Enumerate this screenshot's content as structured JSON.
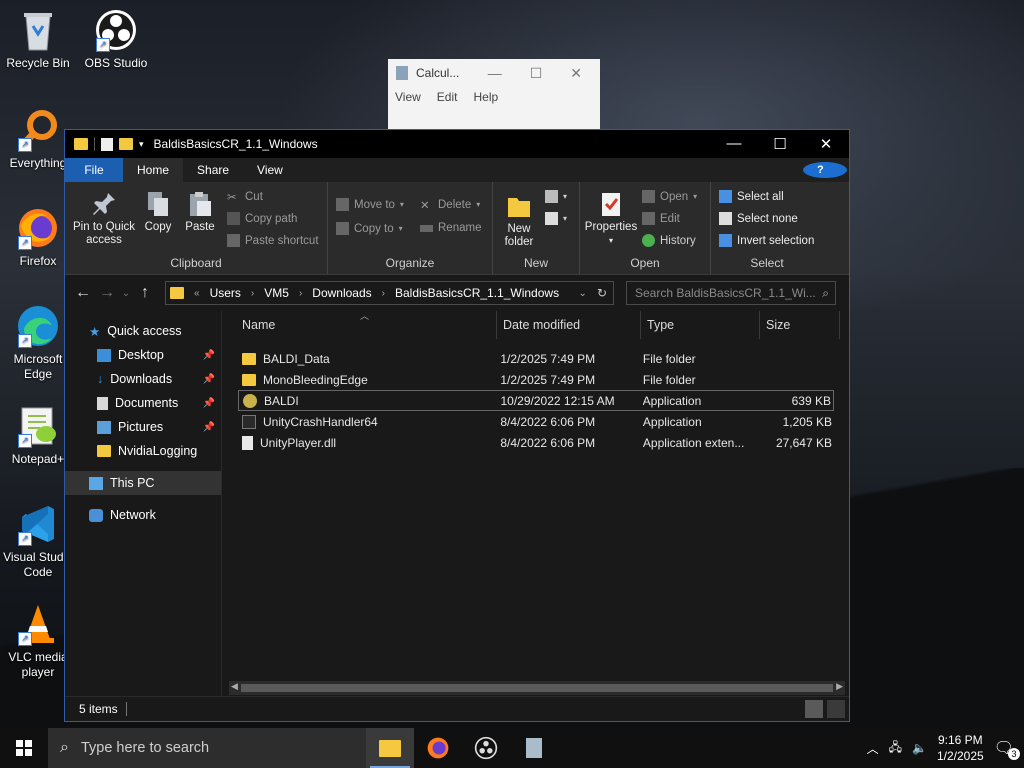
{
  "desktop": {
    "icons": [
      {
        "label": "Recycle Bin"
      },
      {
        "label": "OBS Studio"
      },
      {
        "label": "Everything"
      },
      {
        "label": "Firefox"
      },
      {
        "label": "Microsoft Edge"
      },
      {
        "label": "Notepad+"
      },
      {
        "label": "Visual Studio Code"
      },
      {
        "label": "VLC media player"
      }
    ]
  },
  "calculator": {
    "title": "Calcul...",
    "menu": [
      "View",
      "Edit",
      "Help"
    ]
  },
  "explorer": {
    "title": "BaldisBasicsCR_1.1_Windows",
    "tabs": [
      "File",
      "Home",
      "Share",
      "View"
    ],
    "help": "?",
    "ribbon": {
      "clipboard": {
        "label": "Clipboard",
        "pin": "Pin to Quick access",
        "copy": "Copy",
        "paste": "Paste",
        "cut": "Cut",
        "copy_path": "Copy path",
        "paste_shortcut": "Paste shortcut"
      },
      "organize": {
        "label": "Organize",
        "move_to": "Move to",
        "copy_to": "Copy to",
        "delete": "Delete",
        "rename": "Rename"
      },
      "new": {
        "label": "New",
        "new_folder": "New folder"
      },
      "open": {
        "label": "Open",
        "properties": "Properties",
        "open": "Open",
        "edit": "Edit",
        "history": "History"
      },
      "select": {
        "label": "Select",
        "select_all": "Select all",
        "select_none": "Select none",
        "invert": "Invert selection"
      }
    },
    "address": {
      "prefix": "«",
      "path": [
        "Users",
        "VM5",
        "Downloads",
        "BaldisBasicsCR_1.1_Windows"
      ],
      "search_placeholder": "Search BaldisBasicsCR_1.1_Wi..."
    },
    "nav": {
      "quick_access": "Quick access",
      "items": [
        "Desktop",
        "Downloads",
        "Documents",
        "Pictures",
        "NvidiaLogging"
      ],
      "this_pc": "This PC",
      "network": "Network"
    },
    "columns": {
      "name": "Name",
      "date": "Date modified",
      "type": "Type",
      "size": "Size"
    },
    "files": [
      {
        "name": "BALDI_Data",
        "date": "1/2/2025 7:49 PM",
        "type": "File folder",
        "size": "",
        "kind": "folder"
      },
      {
        "name": "MonoBleedingEdge",
        "date": "1/2/2025 7:49 PM",
        "type": "File folder",
        "size": "",
        "kind": "folder"
      },
      {
        "name": "BALDI",
        "date": "10/29/2022 12:15 AM",
        "type": "Application",
        "size": "639 KB",
        "kind": "app"
      },
      {
        "name": "UnityCrashHandler64",
        "date": "8/4/2022 6:06 PM",
        "type": "Application",
        "size": "1,205 KB",
        "kind": "exe"
      },
      {
        "name": "UnityPlayer.dll",
        "date": "8/4/2022 6:06 PM",
        "type": "Application exten...",
        "size": "27,647 KB",
        "kind": "dll"
      }
    ],
    "status": "5 items"
  },
  "taskbar": {
    "search_placeholder": "Type here to search",
    "time": "9:16 PM",
    "date": "1/2/2025",
    "notifications": "3"
  },
  "colors": {
    "accent": "#1c5fb0",
    "folder": "#f5c93f"
  }
}
